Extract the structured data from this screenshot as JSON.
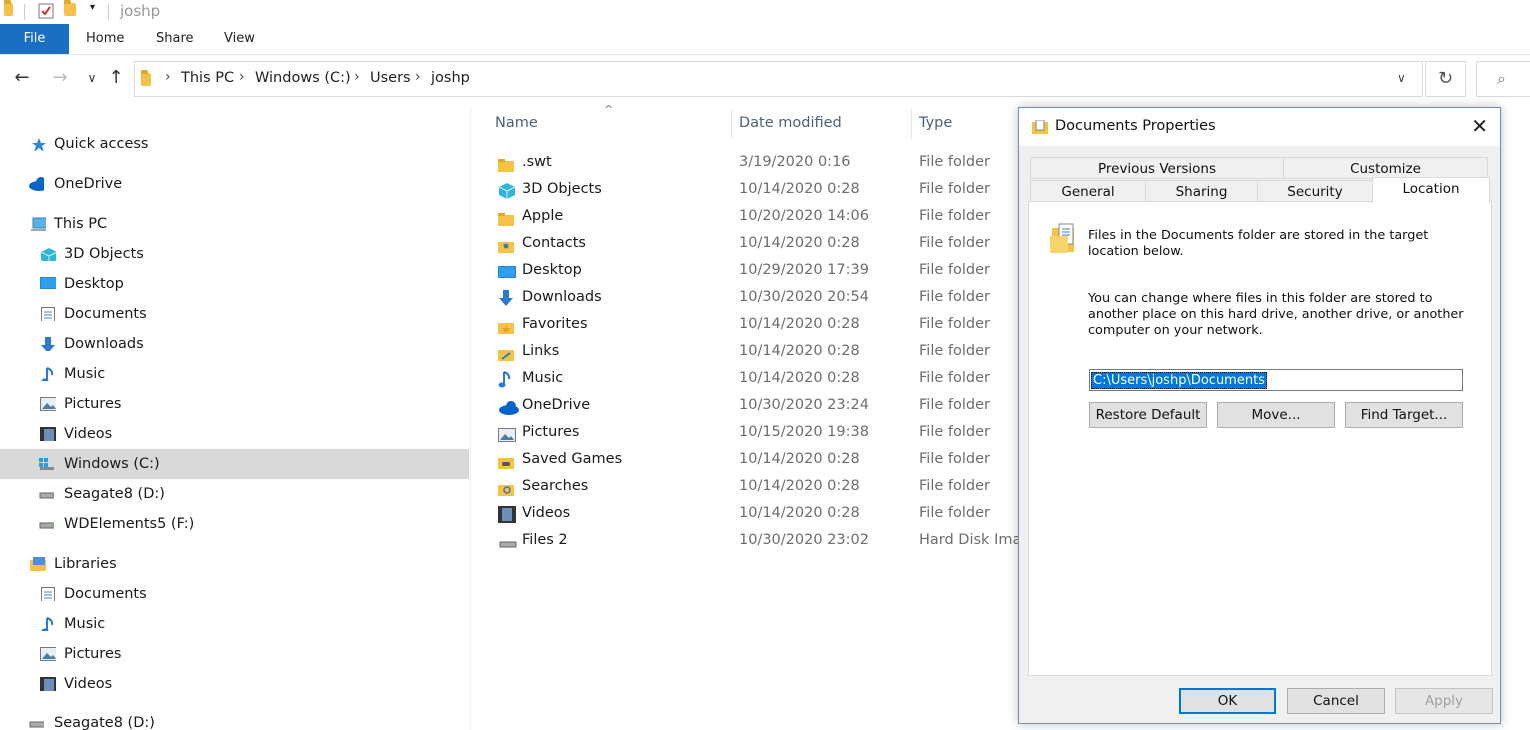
{
  "window": {
    "title": "joshp"
  },
  "ribbon": {
    "tabs": [
      "File",
      "Home",
      "Share",
      "View"
    ]
  },
  "address": {
    "crumbs": [
      "This PC",
      "Windows (C:)",
      "Users",
      "joshp"
    ],
    "back_glyph": "←",
    "forward_glyph": "→",
    "recent_glyph": "∨",
    "up_glyph": "↑",
    "dropdown_glyph": "∨",
    "refresh_glyph": "↻",
    "search_glyph": "⌕"
  },
  "sidebar": {
    "items": [
      {
        "label": "Quick access",
        "icon": "star-icon"
      },
      {
        "label": "OneDrive",
        "icon": "cloud-icon"
      },
      {
        "label": "This PC",
        "icon": "computer-icon"
      },
      {
        "label": "3D Objects",
        "icon": "cube-icon"
      },
      {
        "label": "Desktop",
        "icon": "desktop-icon"
      },
      {
        "label": "Documents",
        "icon": "document-icon"
      },
      {
        "label": "Downloads",
        "icon": "download-icon"
      },
      {
        "label": "Music",
        "icon": "music-icon"
      },
      {
        "label": "Pictures",
        "icon": "picture-icon"
      },
      {
        "label": "Videos",
        "icon": "video-icon"
      },
      {
        "label": "Windows (C:)",
        "icon": "windows-drive-icon"
      },
      {
        "label": "Seagate8 (D:)",
        "icon": "drive-icon"
      },
      {
        "label": "WDElements5 (F:)",
        "icon": "drive-icon"
      },
      {
        "label": "Libraries",
        "icon": "library-icon"
      },
      {
        "label": "Documents",
        "icon": "document-icon"
      },
      {
        "label": "Music",
        "icon": "music-icon"
      },
      {
        "label": "Pictures",
        "icon": "picture-icon"
      },
      {
        "label": "Videos",
        "icon": "video-icon"
      },
      {
        "label": "Seagate8 (D:)",
        "icon": "drive-icon"
      }
    ]
  },
  "filelist": {
    "columns": [
      "Name",
      "Date modified",
      "Type"
    ],
    "sort_glyph": "^",
    "rows": [
      {
        "name": ".swt",
        "date": "3/19/2020 0:16",
        "type": "File folder",
        "icon": "folder-icon"
      },
      {
        "name": "3D Objects",
        "date": "10/14/2020 0:28",
        "type": "File folder",
        "icon": "cube-icon"
      },
      {
        "name": "Apple",
        "date": "10/20/2020 14:06",
        "type": "File folder",
        "icon": "folder-icon"
      },
      {
        "name": "Contacts",
        "date": "10/14/2020 0:28",
        "type": "File folder",
        "icon": "contacts-icon"
      },
      {
        "name": "Desktop",
        "date": "10/29/2020 17:39",
        "type": "File folder",
        "icon": "desktop-icon"
      },
      {
        "name": "Downloads",
        "date": "10/30/2020 20:54",
        "type": "File folder",
        "icon": "download-icon"
      },
      {
        "name": "Favorites",
        "date": "10/14/2020 0:28",
        "type": "File folder",
        "icon": "favorites-icon"
      },
      {
        "name": "Links",
        "date": "10/14/2020 0:28",
        "type": "File folder",
        "icon": "links-icon"
      },
      {
        "name": "Music",
        "date": "10/14/2020 0:28",
        "type": "File folder",
        "icon": "music-icon"
      },
      {
        "name": "OneDrive",
        "date": "10/30/2020 23:24",
        "type": "File folder",
        "icon": "cloud-icon"
      },
      {
        "name": "Pictures",
        "date": "10/15/2020 19:38",
        "type": "File folder",
        "icon": "picture-icon"
      },
      {
        "name": "Saved Games",
        "date": "10/14/2020 0:28",
        "type": "File folder",
        "icon": "saved-games-icon"
      },
      {
        "name": "Searches",
        "date": "10/14/2020 0:28",
        "type": "File folder",
        "icon": "searches-icon"
      },
      {
        "name": "Videos",
        "date": "10/14/2020 0:28",
        "type": "File folder",
        "icon": "video-icon"
      },
      {
        "name": "Files 2",
        "date": "10/30/2020 23:02",
        "type": "Hard Disk Imag",
        "icon": "disk-image-icon"
      }
    ]
  },
  "dialog": {
    "title": "Documents Properties",
    "close_glyph": "✕",
    "tabs_top": [
      "Previous Versions",
      "Customize"
    ],
    "tabs_bottom": [
      "General",
      "Sharing",
      "Security",
      "Location"
    ],
    "active_tab": "Location",
    "text1": "Files in the Documents folder are stored in the target location below.",
    "text2": "You can change where files in this folder are stored to another place on this hard drive, another drive, or another computer on your network.",
    "path_value": "C:\\Users\\joshp\\Documents",
    "buttons": {
      "restore": "Restore Default",
      "move": "Move...",
      "find": "Find Target..."
    },
    "footer": {
      "ok": "OK",
      "cancel": "Cancel",
      "apply": "Apply"
    }
  },
  "colors": {
    "accent": "#1a6fc4",
    "selection": "#d9d9d9",
    "folder": "#f4c247"
  }
}
